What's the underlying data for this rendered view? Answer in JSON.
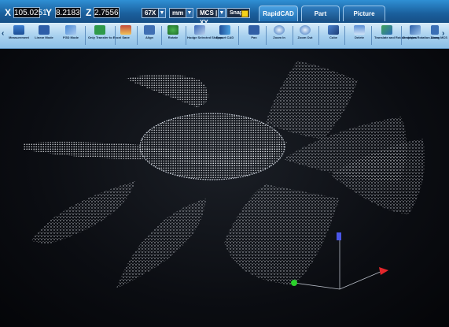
{
  "readout": {
    "x_label": "X",
    "x_value": "105.0251",
    "y_label": "Y",
    "y_value": "8.2183",
    "z_label": "Z",
    "z_value": "2.7556"
  },
  "toolbar": {
    "zoom_select": "67X",
    "units_select": "mm",
    "plane_select": "MCS | XY",
    "snap_label": "Snap",
    "snap_color": "#f5d21a"
  },
  "tabs": [
    {
      "label": "RapidCAD",
      "active": true
    },
    {
      "label": "Part Program",
      "active": false
    },
    {
      "label": "Picture Viewer",
      "active": false
    }
  ],
  "ribbon": {
    "buttons": [
      {
        "label": "Measurement",
        "icon": "ruler-icon"
      },
      {
        "label": "Linear Mode",
        "icon": "linear-mode-icon"
      },
      {
        "label": "FGD Mode",
        "icon": "fgd-mode-icon"
      },
      {
        "label": "Only Transfer to Excel",
        "icon": "excel-icon"
      },
      {
        "label": "Save",
        "icon": "save-icon"
      },
      {
        "label": "Align",
        "icon": "align-icon"
      },
      {
        "label": "Rotate",
        "icon": "rotate-icon"
      },
      {
        "label": "Hodge Selected Shapes",
        "icon": "shapes-icon"
      },
      {
        "label": "Export CAD",
        "icon": "export-icon"
      },
      {
        "label": "Pan",
        "icon": "pan-icon"
      },
      {
        "label": "Zoom In",
        "icon": "zoom-in-icon"
      },
      {
        "label": "Zoom Out",
        "icon": "zoom-out-icon"
      },
      {
        "label": "Cube",
        "icon": "cube-icon"
      },
      {
        "label": "Delete",
        "icon": "delete-icon"
      },
      {
        "label": "Translate and Rotate shapes",
        "icon": "translate-icon"
      },
      {
        "label": "Graphics Rotation Along MCS",
        "icon": "graphics-rotation-icon"
      },
      {
        "label": "Zoom",
        "icon": "zoom-icon"
      }
    ]
  },
  "viewport": {
    "content": "point-cloud-fan",
    "point_color": "#e8ecf2",
    "axis_x_color": "#e3262b",
    "axis_y_color": "#2bd12b",
    "axis_z_color": "#4a56e8"
  }
}
